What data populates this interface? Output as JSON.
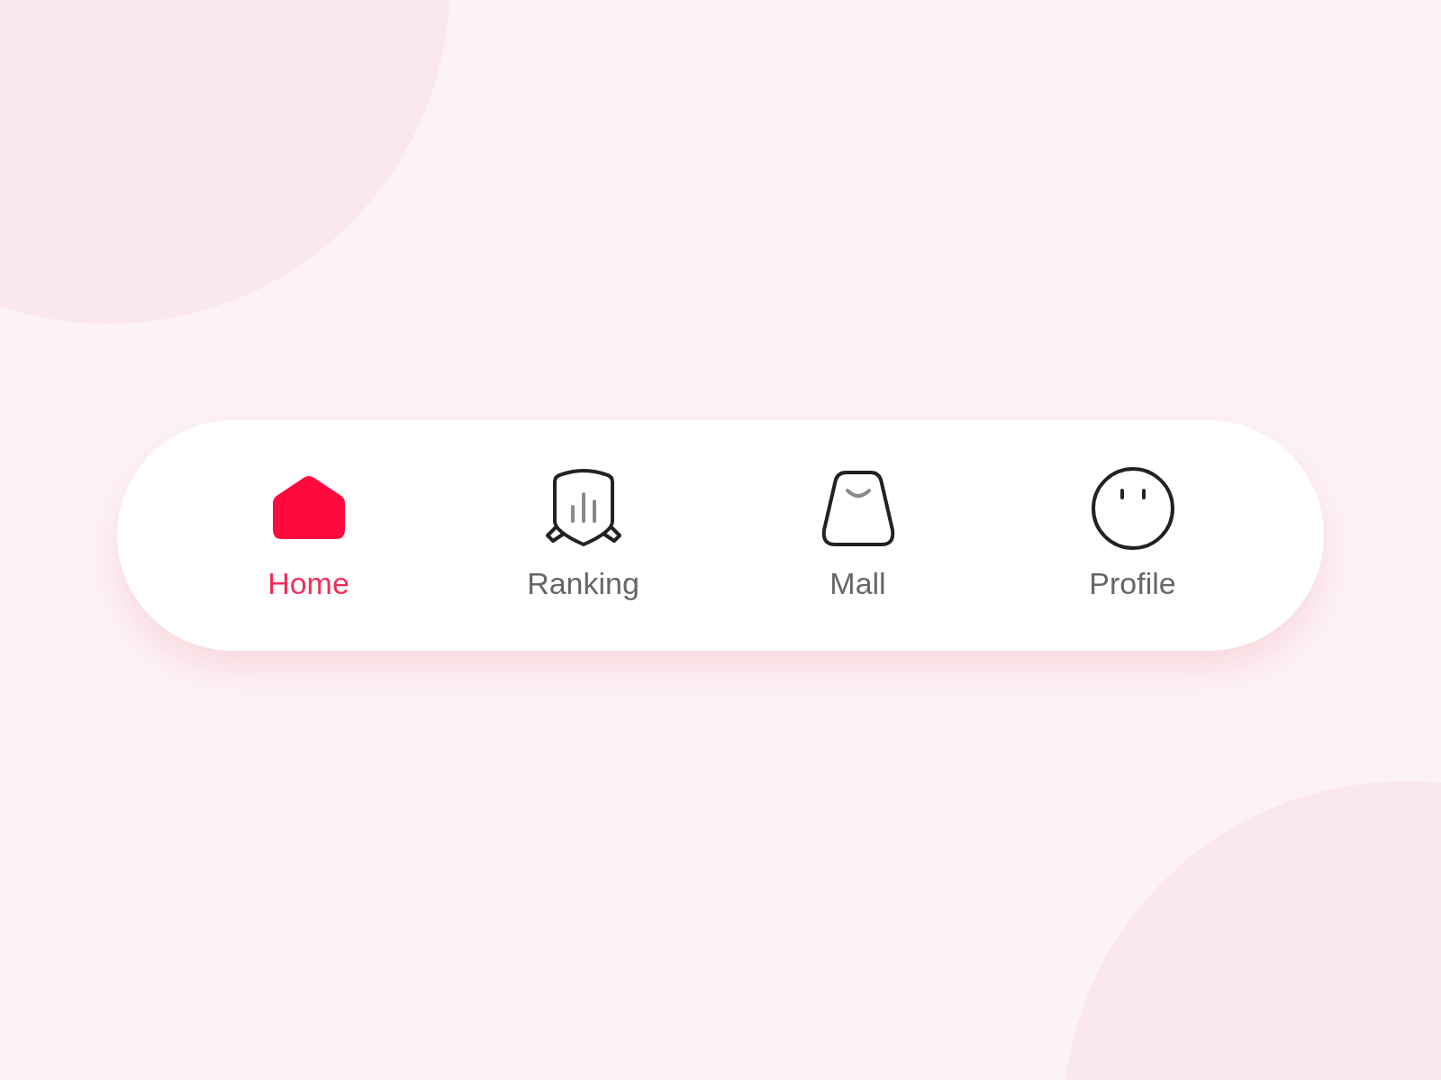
{
  "tab_bar": {
    "tabs": [
      {
        "label": "Home",
        "selected": true
      },
      {
        "label": "Ranking",
        "selected": false
      },
      {
        "label": "Mall",
        "selected": false
      },
      {
        "label": "Profile",
        "selected": false
      }
    ]
  }
}
